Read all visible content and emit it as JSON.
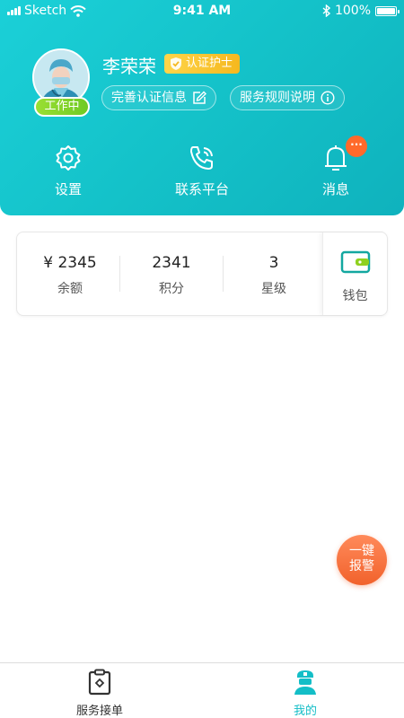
{
  "status_bar": {
    "carrier": "Sketch",
    "time": "9:41 AM",
    "battery": "100%"
  },
  "profile": {
    "name": "李荣荣",
    "cert_label": "认证护士",
    "work_status": "工作中",
    "complete_info_label": "完善认证信息",
    "service_rules_label": "服务规则说明"
  },
  "quick_actions": {
    "settings": "设置",
    "contact": "联系平台",
    "messages": "消息",
    "messages_badge": "···"
  },
  "stats": {
    "balance_value": "¥ 2345",
    "balance_label": "余额",
    "points_value": "2341",
    "points_label": "积分",
    "stars_value": "3",
    "stars_label": "星级",
    "wallet_label": "钱包"
  },
  "sos": {
    "line1": "一键",
    "line2": "报警"
  },
  "tabs": [
    {
      "label": "服务接单",
      "icon": "clipboard-icon",
      "active": false
    },
    {
      "label": "我的",
      "icon": "nurse-icon",
      "active": true
    }
  ],
  "colors": {
    "accent": "#13bec7",
    "badge": "#ff6a2b",
    "cert": "#f5b81e",
    "working": "#7fd02a"
  }
}
